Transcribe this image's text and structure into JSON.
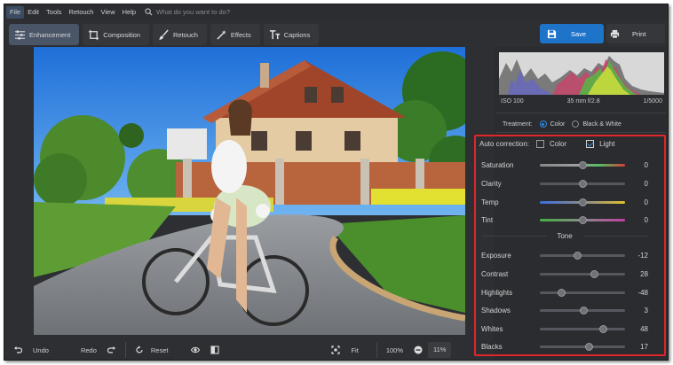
{
  "menu": [
    "File",
    "Edit",
    "Tools",
    "Retouch",
    "View",
    "Help"
  ],
  "search": {
    "placeholder": "What do you want to do?",
    "icon": "search-icon"
  },
  "tabs": [
    {
      "label": "Enhancement",
      "icon": "sliders-icon",
      "active": true
    },
    {
      "label": "Composition",
      "icon": "crop-icon",
      "active": false
    },
    {
      "label": "Retouch",
      "icon": "brush-icon",
      "active": false
    },
    {
      "label": "Effects",
      "icon": "magic-wand-icon",
      "active": false
    },
    {
      "label": "Captions",
      "icon": "text-icon",
      "active": false
    }
  ],
  "actions": {
    "save": "Save",
    "print": "Print"
  },
  "bottombar": {
    "undo": "Undo",
    "redo": "Redo",
    "reset": "Reset",
    "fit": "Fit",
    "zoom_full": "100%",
    "zoom_current": "11%"
  },
  "exif": {
    "iso": "ISO 100",
    "lens": "35 mm f/2.8",
    "shutter": "1/5000"
  },
  "treatment": {
    "label": "Treatment:",
    "options": [
      "Color",
      "Black & White"
    ],
    "selected": "Color"
  },
  "auto_correction": {
    "label": "Auto correction:",
    "color": {
      "label": "Color",
      "checked": false
    },
    "light": {
      "label": "Light",
      "checked": true
    }
  },
  "color_adjustments": [
    {
      "label": "Saturation",
      "value": "0"
    },
    {
      "label": "Clarity",
      "value": "0"
    },
    {
      "label": "Temp",
      "value": "0"
    },
    {
      "label": "Tint",
      "value": "0"
    }
  ],
  "tone_title": "Tone",
  "tone_adjustments": [
    {
      "label": "Exposure",
      "value": "-12"
    },
    {
      "label": "Contrast",
      "value": "28"
    },
    {
      "label": "Highlights",
      "value": "-48"
    },
    {
      "label": "Shadows",
      "value": "3"
    },
    {
      "label": "Whites",
      "value": "48"
    },
    {
      "label": "Blacks",
      "value": "17"
    }
  ],
  "colors": {
    "accent": "#1d74c9",
    "highlight_box": "#e0262b",
    "panel": "#2a2c30",
    "background": "#2d2f33"
  }
}
